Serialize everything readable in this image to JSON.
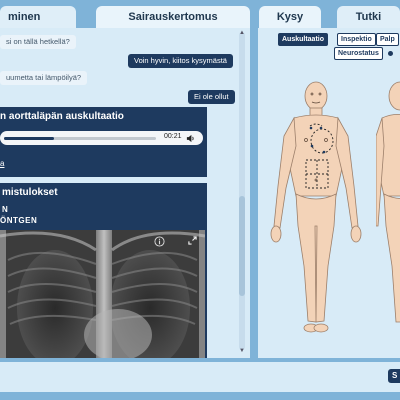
{
  "tabs": {
    "left_partial": "minen",
    "history": "Sairauskertomus",
    "ask": "Kysy",
    "examine": "Tutki"
  },
  "chat": {
    "messages": [
      {
        "side": "in",
        "text": "si on tällä hetkellä?"
      },
      {
        "side": "out",
        "text": "Voin hyvin, kiitos kysymästä"
      },
      {
        "side": "in",
        "text": "uumetta tai lämpöilyä?"
      },
      {
        "side": "out",
        "text": "Ei ole ollut"
      }
    ]
  },
  "audio_card": {
    "title": "n aorttaläpän auskultaatio",
    "time": "00:21",
    "progress": 0.33,
    "link_text": "a"
  },
  "imaging_card": {
    "title": "mistulokset",
    "line1": "N",
    "line2": "ÖNTGEN"
  },
  "exam": {
    "buttons": [
      {
        "label": "Auskultaatio",
        "active": true
      },
      {
        "label": "Inspektio",
        "active": false
      },
      {
        "label": "Palp",
        "active": false
      },
      {
        "label": "Neurostatus",
        "active": false
      }
    ]
  },
  "footer": {
    "button_partial": "S"
  },
  "colors": {
    "background": "#7fb3d8",
    "panel": "#d8ebf7",
    "card": "#1e3a5f",
    "skin": "#f3d3b8"
  }
}
